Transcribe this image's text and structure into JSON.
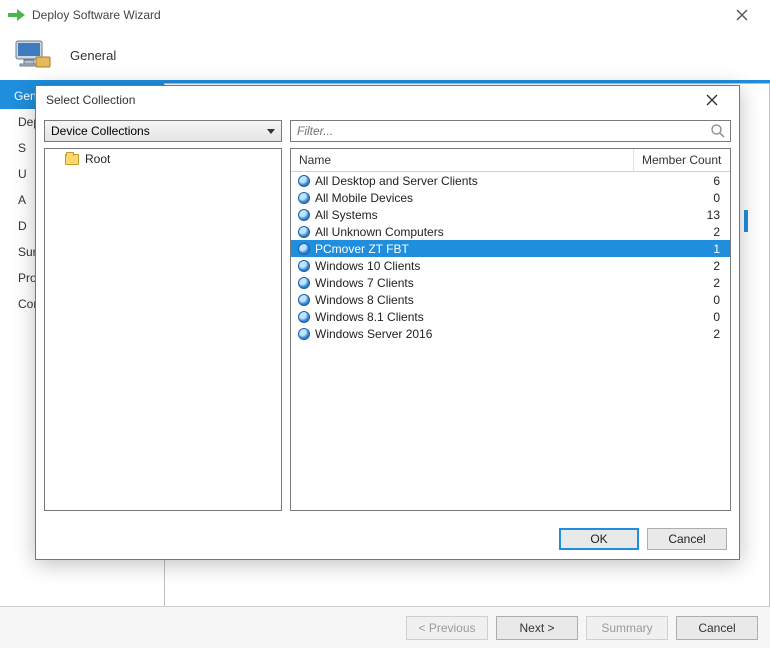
{
  "wizard": {
    "title": "Deploy Software Wizard",
    "header_label": "General",
    "side_items": [
      "Gen",
      "Dep",
      "S",
      "U",
      "A",
      "D",
      "Sum",
      "Prog",
      "Con"
    ],
    "buttons": {
      "previous": "< Previous",
      "next": "Next >",
      "summary": "Summary",
      "cancel": "Cancel"
    }
  },
  "dialog": {
    "title": "Select Collection",
    "combo_value": "Device Collections",
    "filter_placeholder": "Filter...",
    "tree": {
      "root_label": "Root"
    },
    "columns": {
      "name": "Name",
      "count": "Member Count"
    },
    "rows": [
      {
        "name": "All Desktop and Server Clients",
        "count": "6",
        "selected": false
      },
      {
        "name": "All Mobile Devices",
        "count": "0",
        "selected": false
      },
      {
        "name": "All Systems",
        "count": "13",
        "selected": false
      },
      {
        "name": "All Unknown Computers",
        "count": "2",
        "selected": false
      },
      {
        "name": "PCmover ZT FBT",
        "count": "1",
        "selected": true
      },
      {
        "name": "Windows 10 Clients",
        "count": "2",
        "selected": false
      },
      {
        "name": "Windows 7 Clients",
        "count": "2",
        "selected": false
      },
      {
        "name": "Windows 8 Clients",
        "count": "0",
        "selected": false
      },
      {
        "name": "Windows 8.1 Clients",
        "count": "0",
        "selected": false
      },
      {
        "name": "Windows Server 2016",
        "count": "2",
        "selected": false
      }
    ],
    "buttons": {
      "ok": "OK",
      "cancel": "Cancel"
    }
  }
}
